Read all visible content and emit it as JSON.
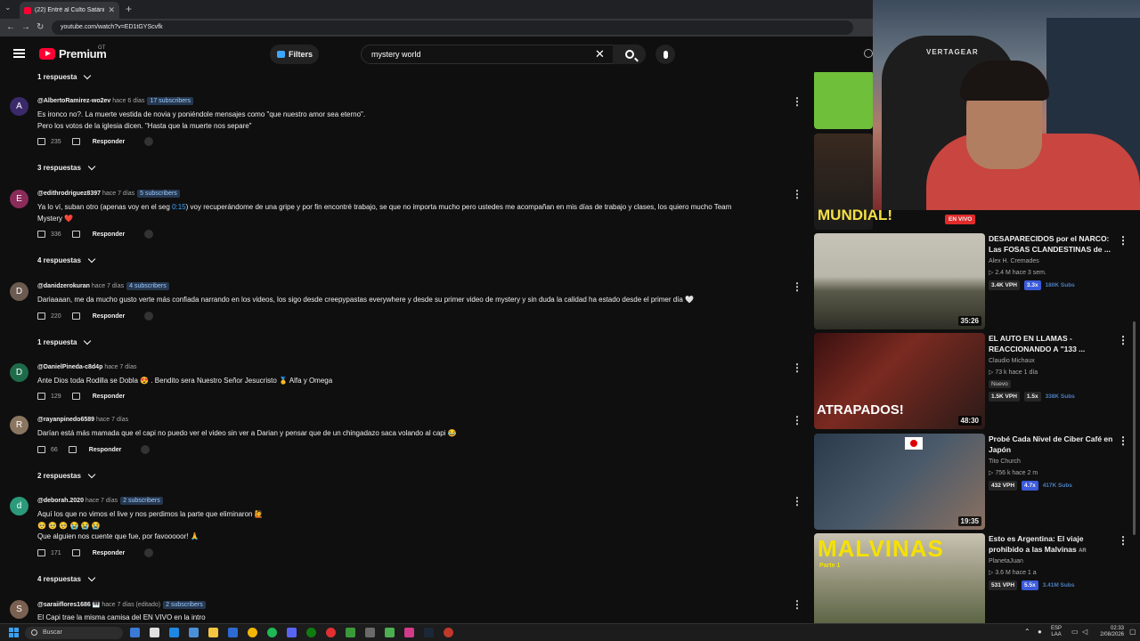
{
  "browser": {
    "tab_title": "(22) Entré al Culto Satánico Má",
    "url": "youtube.com/watch?v=ED1tGYScvfk"
  },
  "header": {
    "logo": "Premium",
    "region": "GT",
    "filters_label": "Filters",
    "search_value": "mystery world"
  },
  "comments": [
    {
      "replies_before": "1 respuesta"
    },
    {
      "handle": "@AlbertoRamirez-wo2ev",
      "time": "hace 6 días",
      "subs": "17 subscribers",
      "lines": [
        "Es ironco no?. La muerte vestida de novia y poniéndole mensajes como \"que nuestro amor sea eterno\".",
        "Pero los votos de la iglesia dicen. \"Hasta que la muerte nos separe\""
      ],
      "likes": "235",
      "reply": "Responder",
      "replies": "3 respuestas"
    },
    {
      "handle": "@edithrodriguez8397",
      "time": "hace 7 días",
      "subs": "5 subscribers",
      "line1a": "Ya lo ví, suban otro (apenas voy en el seg ",
      "timestamp": "0:15",
      "line1b": ") voy recuperándome de una gripe y por fin encontré trabajo, se que no importa mucho pero ustedes me acompañan en mis días de trabajo y clases, los quiero mucho Team",
      "line2": "Mystery ❤️",
      "likes": "336",
      "reply": "Responder",
      "replies": "4 respuestas"
    },
    {
      "handle": "@danidzerokuran",
      "time": "hace 7 días",
      "subs": "4 subscribers",
      "lines": [
        "Dariaaaan, me da mucho gusto verte más confiada narrando en los videos, los sigo desde creepypastas everywhere y desde su primer video de mystery y sin duda la calidad ha estado desde el primer día 🤍"
      ],
      "likes": "220",
      "reply": "Responder",
      "replies": "1 respuesta"
    },
    {
      "handle": "@DanielPineda-c8d4p",
      "time": "hace 7 días",
      "avatar_letter": "D",
      "lines": [
        "Ante Dios toda Rodilla se Dobla 😍 . Bendito sera Nuestro Señor Jesucristo 🥇 Alfa y Omega"
      ],
      "likes": "129",
      "reply": "Responder"
    },
    {
      "handle": "@rayanpinedo6589",
      "time": "hace 7 días",
      "lines": [
        "Darían está más mamada que el capi no puedo ver el video sin ver a Darian y pensar que de un chingadazo saca volando al capi 😂"
      ],
      "likes": "66",
      "reply": "Responder",
      "replies": "2 respuestas"
    },
    {
      "handle": "@deborah.2020",
      "time": "hace 7 días",
      "subs": "2 subscribers",
      "avatar_letter": "d",
      "lines": [
        "Aquí los que no vimos el live y nos perdimos la parte que eliminaron 🙋",
        "🥺 🥺 🥺 😭 😭 😭",
        "Que alguien nos cuente que fue, por favooooor! 🙏"
      ],
      "likes": "171",
      "reply": "Responder",
      "replies": "4 respuestas"
    },
    {
      "handle": "@saraiiflores1686 🎹",
      "time": "hace 7 días (editado)",
      "subs": "2 subscribers",
      "lines": [
        "El Capi trae la misma camisa  del  EN VIVO en la intro"
      ]
    }
  ],
  "sidebar": {
    "live_label": "EN VIVO",
    "mundial_text": "MUNDIAL!",
    "videos": [
      {
        "title": "DESAPARECIDOS por el NARCO: Las FOSAS CLANDESTINAS de ...",
        "channel": "Alex H. Cremades",
        "stats": "▷ 2.4 M   hace 3 sem.",
        "vph": "3.4K VPH",
        "mult": "3.3x",
        "subs": "180K Subs",
        "duration": "35:26"
      },
      {
        "title": "EL AUTO EN LLAMAS - REACCIONANDO A \"133 ...",
        "channel": "Claudio Michaux",
        "stats": "▷ 73 k   hace 1 día",
        "badge": "Nuevo",
        "vph": "1.5K VPH",
        "mult": "1.5x",
        "subs": "338K Subs",
        "duration": "48:30",
        "overlay": "ATRAPADOS!"
      },
      {
        "title": "Probé Cada Nivel de Ciber Café en Japón",
        "channel": "Tito Church",
        "stats": "▷ 756 k   hace 2 m",
        "vph": "432 VPH",
        "mult": "4.7x",
        "subs": "417K Subs",
        "duration": "19:35"
      },
      {
        "title": "Esto es Argentina: El viaje prohibido a las Malvinas",
        "title_suffix": "AR",
        "channel": "PlanetaJuan",
        "stats": "▷ 3.6 M   hace 1 a",
        "vph": "531 VPH",
        "mult": "5.5x",
        "subs": "3.41M Subs",
        "overlay": "MALVINAS",
        "overlay2": "Parte 1"
      }
    ]
  },
  "webcam": {
    "chair_brand": "VERTAGEAR"
  },
  "taskbar": {
    "search": "Buscar",
    "lang1": "ESP",
    "lang2": "LAA",
    "time": "02:33",
    "date": "2/08/2026"
  }
}
